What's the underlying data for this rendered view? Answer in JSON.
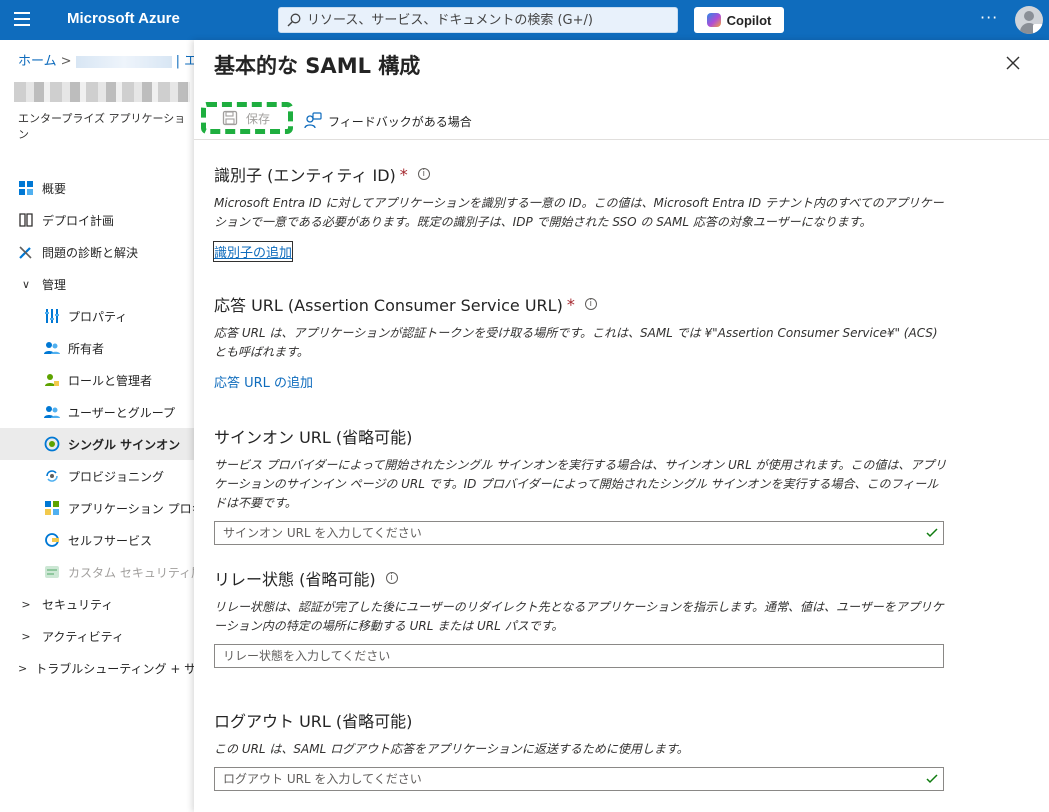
{
  "topbar": {
    "brand": "Microsoft Azure",
    "search_placeholder": "リソース、サービス、ドキュメントの検索 (G+/)",
    "copilot_label": "Copilot",
    "more_label": "···"
  },
  "sidebar": {
    "breadcrumb_home": "ホーム",
    "breadcrumb_sep": ">",
    "breadcrumb_tail": "| エ",
    "app_subtitle": "エンタープライズ アプリケーション",
    "items": [
      {
        "label": "概要"
      },
      {
        "label": "デプロイ計画"
      },
      {
        "label": "問題の診断と解決"
      },
      {
        "label": "管理"
      },
      {
        "label": "プロパティ"
      },
      {
        "label": "所有者"
      },
      {
        "label": "ロールと管理者"
      },
      {
        "label": "ユーザーとグループ"
      },
      {
        "label": "シングル サインオン"
      },
      {
        "label": "プロビジョニング"
      },
      {
        "label": "アプリケーション プロキシ"
      },
      {
        "label": "セルフサービス"
      },
      {
        "label": "カスタム セキュリティ属性"
      },
      {
        "label": "セキュリティ"
      },
      {
        "label": "アクティビティ"
      },
      {
        "label": "トラブルシューティング + サポート"
      }
    ]
  },
  "blade": {
    "title": "基本的な SAML 構成",
    "toolbar": {
      "save_label": "保存",
      "feedback_label": "フィードバックがある場合"
    },
    "sections": {
      "identifier": {
        "title": "識別子 (エンティティ ID)",
        "required": "*",
        "desc": "Microsoft Entra ID に対してアプリケーションを識別する一意の ID。この値は、Microsoft Entra ID テナント内のすべてのアプリケーションで一意である必要があります。既定の識別子は、IDP で開始された SSO の SAML 応答の対象ユーザーになります。",
        "link": "識別子の追加"
      },
      "reply_url": {
        "title": "応答 URL (Assertion Consumer Service URL)",
        "required": "*",
        "desc": "応答 URL は、アプリケーションが認証トークンを受け取る場所です。これは、SAML では ¥\"Assertion Consumer Service¥\" (ACS) とも呼ばれます。",
        "link": "応答 URL の追加"
      },
      "signon_url": {
        "title": "サインオン URL (省略可能)",
        "desc": "サービス プロバイダーによって開始されたシングル サインオンを実行する場合は、サインオン URL が使用されます。この値は、アプリケーションのサインイン ページの URL です。ID プロバイダーによって開始されたシングル サインオンを実行する場合、このフィールドは不要です。",
        "placeholder": "サインオン URL を入力してください"
      },
      "relay_state": {
        "title": "リレー状態 (省略可能)",
        "desc": "リレー状態は、認証が完了した後にユーザーのリダイレクト先となるアプリケーションを指示します。通常、値は、ユーザーをアプリケーション内の特定の場所に移動する URL または URL パスです。",
        "placeholder": "リレー状態を入力してください"
      },
      "logout_url": {
        "title": "ログアウト URL (省略可能)",
        "desc": "この URL は、SAML ログアウト応答をアプリケーションに返送するために使用します。",
        "placeholder": "ログアウト URL を入力してください"
      }
    }
  }
}
